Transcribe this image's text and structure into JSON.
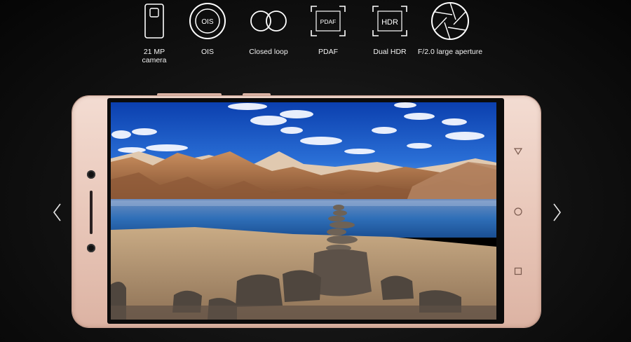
{
  "features": [
    {
      "icon": "phone-camera-icon",
      "label_line1": "21 MP",
      "label_line2": "camera"
    },
    {
      "icon": "ois-icon",
      "badge": "OIS",
      "label_line1": "OIS",
      "label_line2": ""
    },
    {
      "icon": "closed-loop-icon",
      "label_line1": "Closed loop",
      "label_line2": ""
    },
    {
      "icon": "pdaf-icon",
      "badge": "PDAF",
      "label_line1": "PDAF",
      "label_line2": ""
    },
    {
      "icon": "hdr-icon",
      "badge": "HDR",
      "label_line1": "Dual HDR",
      "label_line2": ""
    },
    {
      "icon": "aperture-icon",
      "label_line1": "F/2.0 large aperture",
      "label_line2": ""
    }
  ],
  "carousel": {
    "prev_icon": "chevron-left-icon",
    "next_icon": "chevron-right-icon"
  },
  "phone": {
    "screen_image": "mountain-lake-landscape",
    "nav_icons": [
      "back-triangle-icon",
      "home-circle-icon",
      "recent-square-icon"
    ],
    "body_color": "#e8c6b8"
  }
}
